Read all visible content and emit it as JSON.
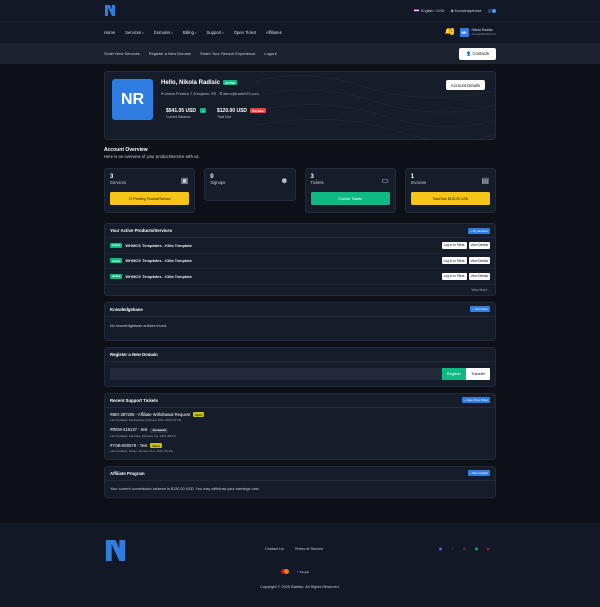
{
  "topbar": {
    "language": "English / USD",
    "knowledgebase": "Knowledgebase",
    "cart_count": "0"
  },
  "nav": {
    "items": [
      {
        "label": "Home",
        "caret": false
      },
      {
        "label": "Services",
        "caret": true
      },
      {
        "label": "Domains",
        "caret": true
      },
      {
        "label": "Billing",
        "caret": true
      },
      {
        "label": "Support",
        "caret": true
      },
      {
        "label": "Open Ticket",
        "caret": false
      },
      {
        "label": "Affiliates",
        "caret": false
      }
    ],
    "notif_count": "1",
    "user": {
      "initials": "NR",
      "name": "Nikola Radisic",
      "email": "demo@radisic023.com"
    }
  },
  "subnav": {
    "items": [
      "Order New Services",
      "Register a New Domain",
      "Share Your Service Experience",
      "Logout"
    ],
    "contacts": "Contacts"
  },
  "hero": {
    "initials": "NR",
    "greeting": "Hello, Nikola Radisic",
    "status": "ACTIVE",
    "address": "Umica Predica 7 Zrenjanin, RS",
    "email": "demo@rade023.com",
    "balance": "$541.05 USD",
    "balance_label": "Current Balance",
    "due": "$120.00 USD",
    "due_badge": "Pay Now",
    "due_label": "Total Due",
    "account_btn": "Account Details"
  },
  "overview": {
    "title": "Account Overview",
    "subtitle": "Here is an overview of your product/service with us."
  },
  "stats": [
    {
      "num": "3",
      "label": "Services",
      "btn": "12 Pending Product/Service",
      "style": "y",
      "icon": "▣"
    },
    {
      "num": "0",
      "label": "Signups",
      "btn": "",
      "style": "",
      "icon": "☻"
    },
    {
      "num": "3",
      "label": "Tickets",
      "btn": "3 Active Tickets",
      "style": "g",
      "icon": "▭"
    },
    {
      "num": "1",
      "label": "Invoices",
      "btn": "Total Due $120.00 USD",
      "style": "y",
      "icon": "▤"
    }
  ],
  "products": {
    "title": "Your Active Products/Services",
    "btn": "+ My Services",
    "rows": [
      {
        "status": "Active",
        "name": "WHMCS Templates - Killa Template",
        "login": "Log in to Plesk",
        "view": "View Details"
      },
      {
        "status": "Active",
        "name": "WHMCS Templates - Killa Template",
        "login": "Log in to Plesk",
        "view": "View Details"
      },
      {
        "status": "Active",
        "name": "WHMCS Templates - Killa Template",
        "login": "Log in to Plesk",
        "view": "View Details"
      }
    ],
    "more": "View More..."
  },
  "kb": {
    "title": "Knowledgebase",
    "btn": "+ View More",
    "body": "No knowledgebase articles found."
  },
  "domain": {
    "title": "Register a New Domain",
    "register": "Register",
    "transfer": "Transfer"
  },
  "tickets": {
    "title": "Recent Support Tickets",
    "btn": "+ Open New Ticket",
    "rows": [
      {
        "subject": "#BEI-387205 - Affiliate Withdrawal Request",
        "badge": "Open",
        "cls": "b-yellow",
        "updated": "Last Updated: Wednesday, February 26th, 2025 (07:25)"
      },
      {
        "subject": "#REM-418147 - test",
        "badge": "Answered",
        "cls": "b-dark",
        "updated": "Last Updated: Saturday, February 1st, 2025 (18:27)"
      },
      {
        "subject": "#YSB-830579 - Test",
        "badge": "Open",
        "cls": "b-yellow",
        "updated": "Last Updated: Friday, January 31st, 2025 (15:34)"
      }
    ]
  },
  "affiliate": {
    "title": "Affiliate Program",
    "btn": "+ More Details",
    "body": "Your current commission balance is $120.00 USD. You may withdraw your earnings now."
  },
  "footer": {
    "links": [
      "Contact Us",
      "Terms of Service"
    ],
    "paypal": "Paypal",
    "copyright": "Copyright © 2025 Radisic. All Rights Reserved."
  },
  "colors": {
    "accent": "#2f7de1",
    "bg": "#0d1117",
    "panel": "#161d2a",
    "success": "#10b981",
    "warning": "#f5c518"
  }
}
